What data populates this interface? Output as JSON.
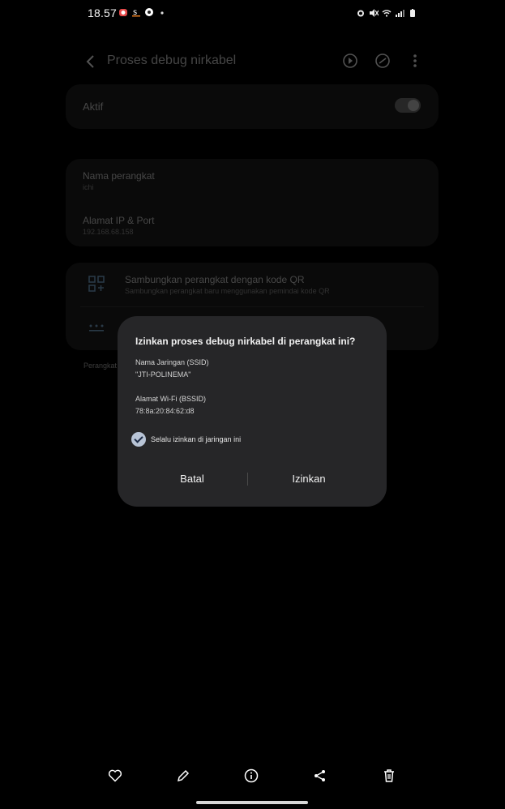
{
  "status": {
    "time": "18.57"
  },
  "topbar": {
    "title": "Proses debug nirkabel"
  },
  "aktif": {
    "label": "Aktif"
  },
  "device": {
    "name_label": "Nama perangkat",
    "name_value": "ichi",
    "ip_label": "Alamat IP & Port",
    "ip_value": "192.168.68.158"
  },
  "pair": {
    "qr_title": "Sambungkan perangkat dengan kode QR",
    "qr_sub": "Sambungkan perangkat baru menggunakan pemindai kode QR",
    "paired_prefix": "Perangkat"
  },
  "dialog": {
    "title": "Izinkan proses debug nirkabel di perangkat ini?",
    "ssid_label": "Nama Jaringan (SSID)",
    "ssid_value": "\"JTI-POLINEMA\"",
    "bssid_label": "Alamat Wi-Fi (BSSID)",
    "bssid_value": "78:8a:20:84:62:d8",
    "always_allow": "Selalu izinkan di jaringan ini",
    "always_allow_checked": true,
    "cancel": "Batal",
    "allow": "Izinkan"
  },
  "icons": {
    "back": "chevron-left-icon",
    "actions": [
      "play-rotate-icon",
      "rotate-lock-icon",
      "more-vertical-icon"
    ],
    "bottom": [
      "heart-icon",
      "pencil-icon",
      "info-icon",
      "share-icon",
      "trash-icon"
    ]
  }
}
